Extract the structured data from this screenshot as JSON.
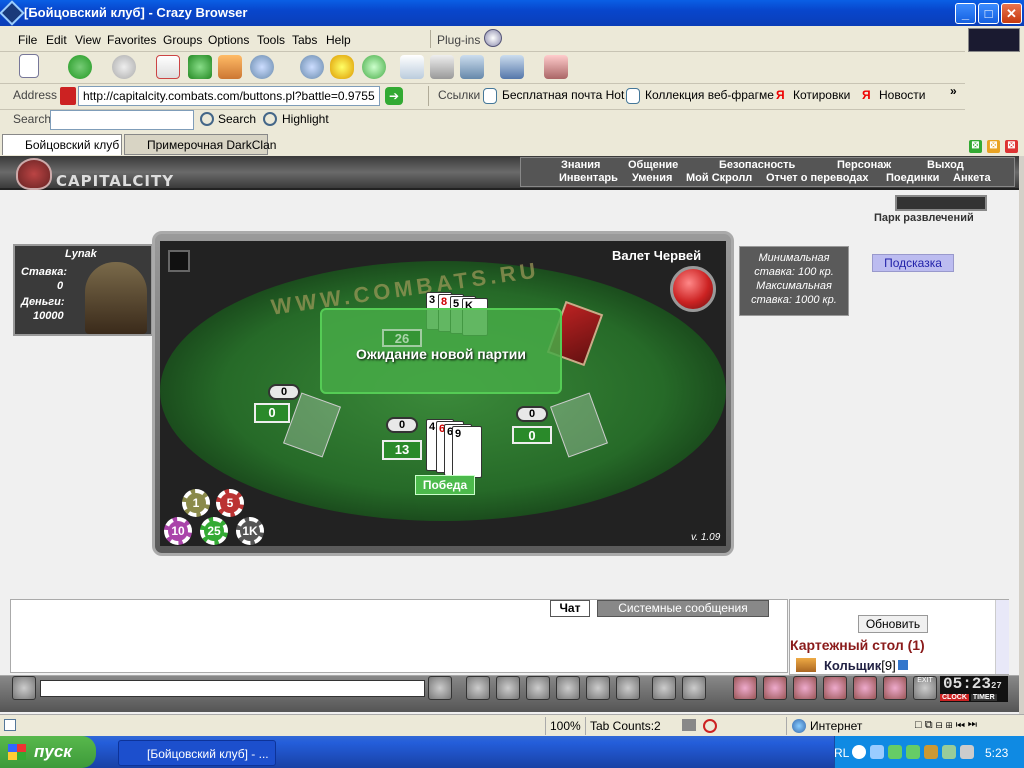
{
  "window": {
    "title": "[Бойцовский клуб] - Crazy Browser",
    "controls": [
      "_",
      "□",
      "✕"
    ]
  },
  "menu": [
    "File",
    "Edit",
    "View",
    "Favorites",
    "Groups",
    "Options",
    "Tools",
    "Tabs",
    "Help"
  ],
  "plugins_label": "Plug-ins",
  "address": {
    "label": "Address",
    "value": "http://capitalcity.combats.com/buttons.pl?battle=0.9755"
  },
  "links": {
    "label": "Ссылки",
    "items": [
      "Бесплатная почта Hot",
      "Коллекция веб-фрагме",
      "Котировки",
      "Новости"
    ]
  },
  "search": {
    "label": "Search",
    "button": "Search",
    "highlight": "Highlight"
  },
  "tabs": [
    "Бойцовский клуб",
    "Примерочная DarkClan"
  ],
  "game": {
    "logo": "CAPITALCITY",
    "nav_top": [
      "Знания",
      "Общение",
      "Безопасность",
      "Персонаж",
      "Выход"
    ],
    "nav_bottom": [
      "Инвентарь",
      "Умения",
      "Мой Скролл",
      "Отчет о переводах",
      "Поединки",
      "Анкета"
    ],
    "park": "Парк развлечений",
    "hint": "Подсказка",
    "player": {
      "name": "Lynak",
      "stake_label": "Ставка:",
      "stake": "0",
      "money_label": "Деньги:",
      "money": "10000"
    },
    "table": {
      "watermark": "WWW.COMBATS.RU",
      "valet": "Валет Червей",
      "waiting": "Ожидание новой партии",
      "dealer_score": "26",
      "left_bet": "0",
      "left_score": "0",
      "center_bet": "0",
      "center_score": "13",
      "right_bet": "0",
      "right_score": "0",
      "victory": "Победа",
      "version": "v. 1.09",
      "chips": [
        "1",
        "5",
        "10",
        "25",
        "1K"
      ]
    },
    "stakes": {
      "min_label": "Минимальная",
      "min_value": "ставка:   100 кр.",
      "max_label": "Максимальная",
      "max_value": "ставка:   1000 кр."
    },
    "chat_tabs": [
      "Чат",
      "Системные сообщения"
    ],
    "refresh": "Обновить",
    "card_table": "Картежный стол (1)",
    "player_in_list": "Кольщик",
    "player_level": "[9]",
    "clock": "05:23",
    "clock_sec": "27",
    "clock_label": "CLOCK",
    "timer_label": "TIMER",
    "exit_label": "EXIT"
  },
  "statusbar": {
    "zoom": "100%",
    "tab_count": "Tab Counts:2",
    "zone": "Интернет"
  },
  "taskbar": {
    "start": "пуск",
    "task": "[Бойцовский клуб] - ...",
    "lang": "RL",
    "time": "5:23"
  },
  "colors": {
    "title_bar": "#0a46cc",
    "felt": "#266a28",
    "rail": "#8a3a3a",
    "card_table_text": "#8a1a1a",
    "taskbar": "#245edb"
  }
}
